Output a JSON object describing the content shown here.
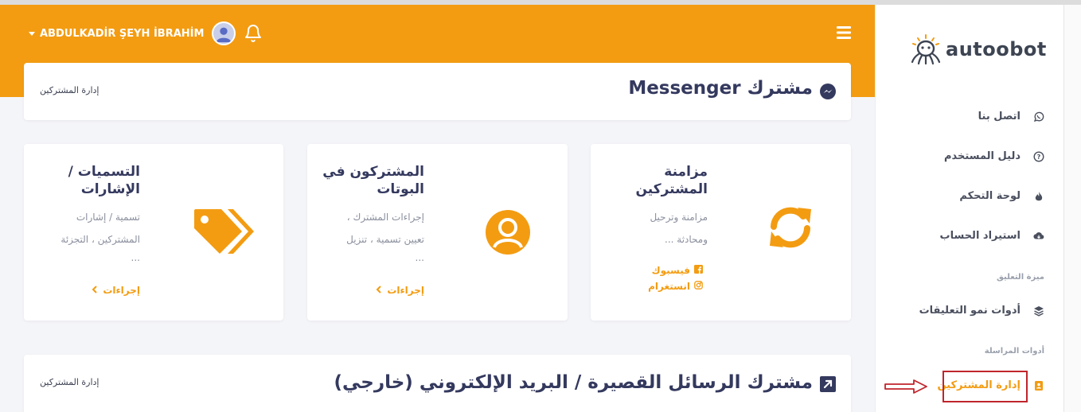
{
  "topbar": {
    "user_name": "ABDULKADİR ŞEYH İBRAHİM"
  },
  "header": {
    "title": "مشترك Messenger",
    "breadcrumb": "إدارة المشتركين"
  },
  "cards": [
    {
      "title": "مزامنة المشتركين",
      "desc_lines": [
        "مزامنة وترحيل",
        "ومحادثة ..."
      ],
      "links": [
        {
          "label": "فيسبوك",
          "icon": "facebook-icon"
        },
        {
          "label": "انستغرام",
          "icon": "instagram-icon"
        }
      ],
      "icon": "sync-icon"
    },
    {
      "title": "المشتركون في البوتات",
      "desc_lines": [
        "إجراءات المشترك ،",
        "تعيين تسمية ، تنزيل",
        "..."
      ],
      "action": "إجراءات",
      "icon": "user-circle-icon"
    },
    {
      "title": "التسميات / الإشارات",
      "desc_lines": [
        "تسمية / إشارات",
        "المشتركين ، التجزئة",
        "..."
      ],
      "action": "إجراءات",
      "icon": "tags-icon"
    }
  ],
  "sms_section": {
    "title": "مشترك الرسائل القصيرة / البريد الإلكتروني (خارجي)",
    "breadcrumb": "إدارة المشتركين"
  },
  "sidebar": {
    "logo_text": "autoobot",
    "items": [
      {
        "label": "اتصل بنا",
        "icon": "whatsapp-icon"
      },
      {
        "label": "دليل المستخدم",
        "icon": "question-circle-icon"
      },
      {
        "label": "لوحة التحكم",
        "icon": "fire-icon"
      },
      {
        "label": "استيراد الحساب",
        "icon": "cloud-download-icon"
      }
    ],
    "section_comments": "ميزة التعليق",
    "comments_item": {
      "label": "أدوات نمو التعليقات",
      "icon": "layers-icon"
    },
    "section_messaging": "أدوات المراسلة",
    "active_item": {
      "label": "إدارة المشتركين",
      "icon": "address-book-icon"
    }
  },
  "colors": {
    "accent": "#f39c12",
    "title": "#34395e",
    "highlight_box": "#c0252c"
  }
}
